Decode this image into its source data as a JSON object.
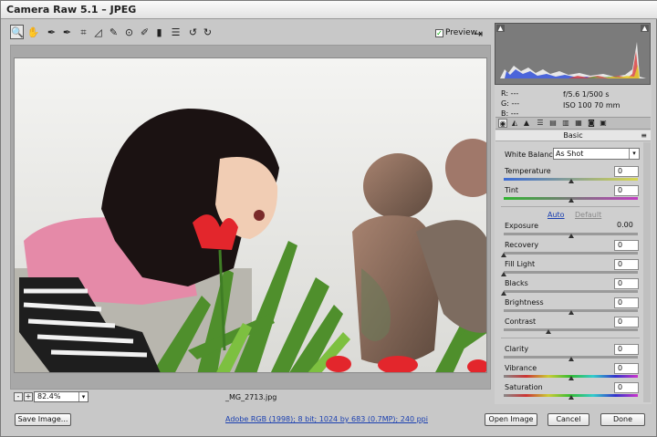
{
  "window": {
    "title": "Camera Raw 5.1  –  JPEG"
  },
  "toolbar": {
    "tools": [
      {
        "name": "zoom-tool",
        "glyph": "🔍"
      },
      {
        "name": "hand-tool",
        "glyph": "✋"
      },
      {
        "name": "white-balance-tool",
        "glyph": "✒"
      },
      {
        "name": "color-sampler-tool",
        "glyph": "✒"
      },
      {
        "name": "crop-tool",
        "glyph": "⌗"
      },
      {
        "name": "straighten-tool",
        "glyph": "◿"
      },
      {
        "name": "spot-removal-tool",
        "glyph": "✎"
      },
      {
        "name": "red-eye-tool",
        "glyph": "⊙"
      },
      {
        "name": "adjustment-brush-tool",
        "glyph": "✐"
      },
      {
        "name": "graduated-filter-tool",
        "glyph": "▮"
      },
      {
        "name": "preferences-tool",
        "glyph": "☰"
      },
      {
        "name": "rotate-ccw-tool",
        "glyph": "↺"
      },
      {
        "name": "rotate-cw-tool",
        "glyph": "↻"
      }
    ],
    "preview_label": "Preview",
    "preview_checked": "✓",
    "export_glyph": "⇥"
  },
  "zoom": {
    "minus": "-",
    "plus": "+",
    "level": "82.4%",
    "arrow": "▾"
  },
  "filename": "_MG_2713.jpg",
  "bottom": {
    "save_label": "Save Image...",
    "workflow_link": "Adobe RGB (1998); 8 bit; 1024 by 683 (0.7MP); 240 ppi",
    "open_label": "Open Image",
    "cancel_label": "Cancel",
    "done_label": "Done"
  },
  "readout": {
    "r": "R:  ---",
    "g": "G:  ---",
    "b": "B:  ---",
    "exposure": "f/5.6   1/500 s",
    "iso": "ISO 100   70 mm"
  },
  "panel": {
    "title": "Basic",
    "menu_glyph": "≡",
    "tabs": [
      "◉",
      "◭",
      "▲",
      "☰",
      "▤",
      "▥",
      "▦",
      "◙",
      "▣"
    ],
    "white_balance_label": "White Balance:",
    "white_balance_value": "As Shot",
    "auto_label": "Auto",
    "default_label": "Default",
    "sliders": [
      {
        "key": "temperature",
        "label": "Temperature",
        "value": "0",
        "level": 0.5
      },
      {
        "key": "tint",
        "label": "Tint",
        "value": "0",
        "level": 0.5
      },
      {
        "key": "exposure",
        "label": "Exposure",
        "value": "0.00",
        "level": 0.5
      },
      {
        "key": "recovery",
        "label": "Recovery",
        "value": "0",
        "level": 0.0
      },
      {
        "key": "fill-light",
        "label": "Fill Light",
        "value": "0",
        "level": 0.0
      },
      {
        "key": "blacks",
        "label": "Blacks",
        "value": "0",
        "level": 0.0
      },
      {
        "key": "brightness",
        "label": "Brightness",
        "value": "0",
        "level": 0.5
      },
      {
        "key": "contrast",
        "label": "Contrast",
        "value": "0",
        "level": 0.33
      },
      {
        "key": "clarity",
        "label": "Clarity",
        "value": "0",
        "level": 0.5
      },
      {
        "key": "vibrance",
        "label": "Vibrance",
        "value": "0",
        "level": 0.5
      },
      {
        "key": "saturation",
        "label": "Saturation",
        "value": "0",
        "level": 0.5
      }
    ]
  },
  "colors": {
    "link": "#1a3fb0",
    "histogram_bg": "#7b7b7b"
  }
}
